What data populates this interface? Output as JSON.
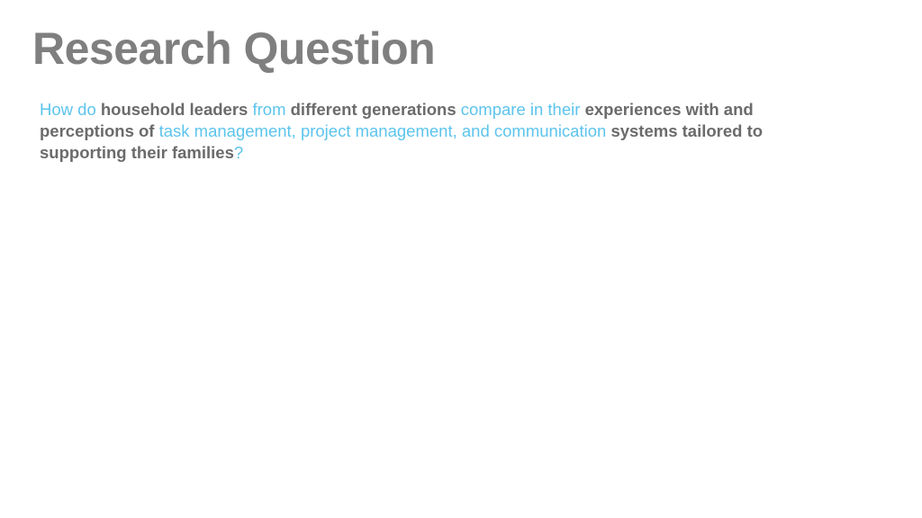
{
  "slide": {
    "title": "Research Question",
    "question_segments": [
      {
        "text": "How do ",
        "style": "light"
      },
      {
        "text": "household leaders ",
        "style": "bold"
      },
      {
        "text": "from ",
        "style": "light"
      },
      {
        "text": "different generations ",
        "style": "bold"
      },
      {
        "text": "compare in their ",
        "style": "light"
      },
      {
        "text": "experiences with and perceptions of ",
        "style": "bold"
      },
      {
        "text": "task management, project management, and communication ",
        "style": "light"
      },
      {
        "text": "systems tailored to supporting their families",
        "style": "bold"
      },
      {
        "text": "?",
        "style": "light"
      }
    ]
  },
  "colors": {
    "title": "#7f7f7f",
    "emphasis_text": "#6b6b6b",
    "accent_text": "#5cc4ec",
    "background": "#ffffff"
  }
}
